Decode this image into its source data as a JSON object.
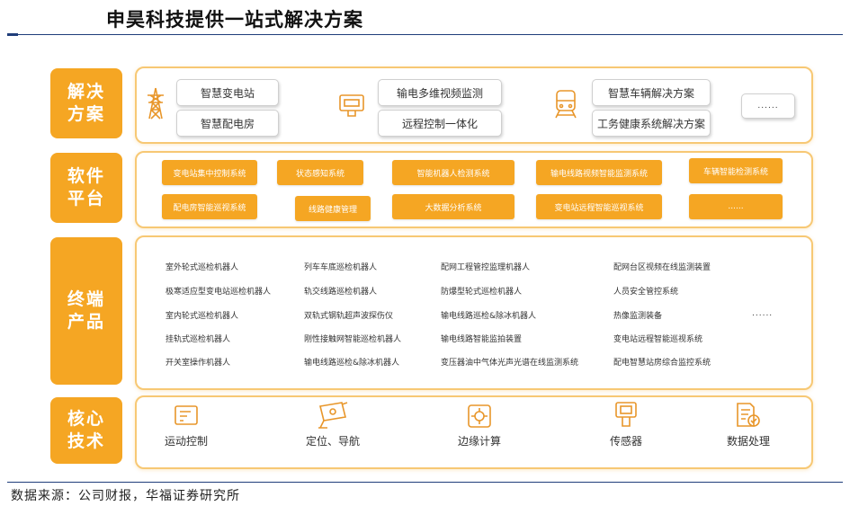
{
  "title": "申昊科技提供一站式解决方案",
  "source": "数据来源：公司财报，华福证券研究所",
  "rows": {
    "solutions": {
      "label": [
        "解决",
        "方案"
      ],
      "items": [
        "智慧变电站",
        "智慧配电房",
        "输电多维视频监测",
        "远程控制一体化",
        "智慧车辆解决方案",
        "工务健康系统解决方案"
      ],
      "more": "......"
    },
    "software": {
      "label": [
        "软件",
        "平台"
      ],
      "items": [
        "变电站集中控制系统",
        "状态感知系统",
        "智能机器人检测系统",
        "输电线路视频智能监测系统",
        "车辆智能检测系统",
        "配电房智能巡视系统",
        "线路健康管理",
        "大数据分析系统",
        "变电站远程智能巡视系统",
        "......"
      ]
    },
    "terminal": {
      "label": [
        "终端",
        "产品"
      ],
      "col1": [
        "室外轮式巡检机器人",
        "极寒适应型变电站巡检机器人",
        "室内轮式巡检机器人",
        "挂轨式巡检机器人",
        "开关室操作机器人"
      ],
      "col2": [
        "列车车底巡检机器人",
        "轨交线路巡检机器人",
        "双轨式钢轨超声波探伤仪",
        "刚性接触网智能巡检机器人",
        "输电线路巡检&除冰机器人"
      ],
      "col3": [
        "配网工程管控监理机器人",
        "防爆型轮式巡检机器人",
        "输电线路巡检&除冰机器人",
        "输电线路智能监拍装置",
        "变压器油中气体光声光谱在线监测系统"
      ],
      "col4": [
        "配网台区视频在线监测装置",
        "人员安全管控系统",
        "热像监测装备",
        "变电站远程智能巡视系统",
        "配电智慧站房综合监控系统"
      ],
      "more": "......"
    },
    "tech": {
      "label": [
        "核心",
        "技术"
      ],
      "items": [
        {
          "label": "运动控制",
          "icon": "motion-control-icon"
        },
        {
          "label": "定位、导航",
          "icon": "camera-navigation-icon"
        },
        {
          "label": "边缘计算",
          "icon": "edge-computing-icon"
        },
        {
          "label": "传感器",
          "icon": "sensor-icon"
        },
        {
          "label": "数据处理",
          "icon": "data-processing-icon"
        }
      ]
    }
  },
  "colors": {
    "accent": "#f5a623",
    "panel_border": "#f7c874",
    "rule": "#1f3d7a"
  }
}
